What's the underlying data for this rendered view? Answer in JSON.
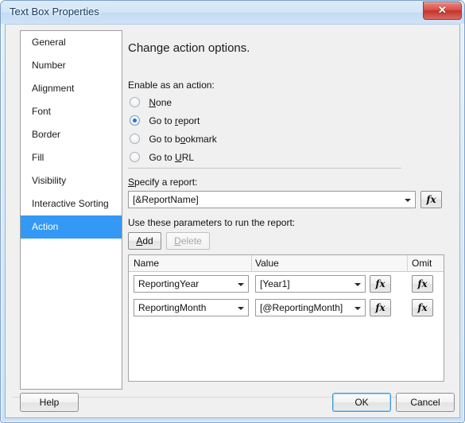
{
  "window": {
    "title": "Text Box Properties",
    "close_label": "✕",
    "close_icon": "close-icon"
  },
  "sidebar": {
    "items": [
      {
        "label": "General",
        "selected": false
      },
      {
        "label": "Number",
        "selected": false
      },
      {
        "label": "Alignment",
        "selected": false
      },
      {
        "label": "Font",
        "selected": false
      },
      {
        "label": "Border",
        "selected": false
      },
      {
        "label": "Fill",
        "selected": false
      },
      {
        "label": "Visibility",
        "selected": false
      },
      {
        "label": "Interactive Sorting",
        "selected": false
      },
      {
        "label": "Action",
        "selected": true
      }
    ],
    "selected_index": 8,
    "selection_color": "#3399f5"
  },
  "pane": {
    "heading": "Change action options.",
    "enable_label": "Enable as an action:",
    "radios": [
      {
        "label": "None",
        "mnemonic_pre": "",
        "mnemonic": "N",
        "mnemonic_post": "one",
        "checked": false
      },
      {
        "label": "Go to report",
        "mnemonic_pre": "Go to ",
        "mnemonic": "r",
        "mnemonic_post": "eport",
        "checked": true
      },
      {
        "label": "Go to bookmark",
        "mnemonic_pre": "Go to b",
        "mnemonic": "o",
        "mnemonic_post": "okmark",
        "checked": false
      },
      {
        "label": "Go to URL",
        "mnemonic_pre": "Go to ",
        "mnemonic": "U",
        "mnemonic_post": "RL",
        "checked": false
      }
    ],
    "specify_label_pre": "",
    "specify_label_mnemonic": "S",
    "specify_label_post": "pecify a report:",
    "report_combo": {
      "value": "[&ReportName]",
      "placeholder": "[&ReportName]"
    },
    "report_fx": {
      "label": "fx",
      "icon": "fx-expression-icon"
    },
    "params_label": "Use these parameters to run the report:",
    "add_button": {
      "pre": "",
      "mnemonic": "A",
      "post": "dd",
      "enabled": true
    },
    "delete_button": {
      "pre": "",
      "mnemonic": "D",
      "post": "elete",
      "enabled": false
    },
    "grid": {
      "columns": [
        "Name",
        "Value",
        "Omit"
      ],
      "rows": [
        {
          "name": "ReportingYear",
          "value": "[Year1]",
          "value_fx": "fx",
          "omit_fx": "fx"
        },
        {
          "name": "ReportingMonth",
          "value": "[@ReportingMonth]",
          "value_fx": "fx",
          "omit_fx": "fx"
        }
      ]
    }
  },
  "footer": {
    "help": "Help",
    "ok": "OK",
    "cancel": "Cancel"
  }
}
